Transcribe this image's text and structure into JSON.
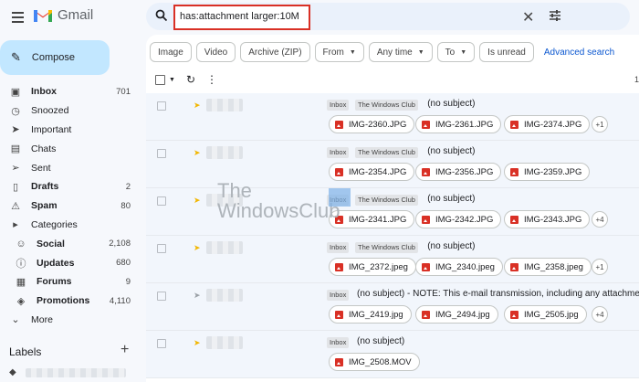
{
  "app": {
    "name": "Gmail"
  },
  "search": {
    "query": "has:attachment larger:10M"
  },
  "compose_label": "Compose",
  "nav": [
    {
      "icon": "inbox-icon",
      "glyph": "▣",
      "label": "Inbox",
      "count": "701",
      "bold": true,
      "sub": false
    },
    {
      "icon": "clock-icon",
      "glyph": "◷",
      "label": "Snoozed",
      "count": "",
      "bold": false,
      "sub": false
    },
    {
      "icon": "important-icon",
      "glyph": "➤",
      "label": "Important",
      "count": "",
      "bold": false,
      "sub": false
    },
    {
      "icon": "chat-icon",
      "glyph": "▤",
      "label": "Chats",
      "count": "",
      "bold": false,
      "sub": false
    },
    {
      "icon": "send-icon",
      "glyph": "➢",
      "label": "Sent",
      "count": "",
      "bold": false,
      "sub": false
    },
    {
      "icon": "draft-icon",
      "glyph": "▯",
      "label": "Drafts",
      "count": "2",
      "bold": true,
      "sub": false
    },
    {
      "icon": "spam-icon",
      "glyph": "⚠",
      "label": "Spam",
      "count": "80",
      "bold": true,
      "sub": false
    },
    {
      "icon": "label-icon",
      "glyph": "▸",
      "label": "Categories",
      "count": "",
      "bold": false,
      "sub": false
    },
    {
      "icon": "people-icon",
      "glyph": "☺",
      "label": "Social",
      "count": "2,108",
      "bold": true,
      "sub": true
    },
    {
      "icon": "info-icon",
      "glyph": "ⓘ",
      "label": "Updates",
      "count": "680",
      "bold": true,
      "sub": true
    },
    {
      "icon": "forum-icon",
      "glyph": "▦",
      "label": "Forums",
      "count": "9",
      "bold": true,
      "sub": true
    },
    {
      "icon": "tag-icon",
      "glyph": "◈",
      "label": "Promotions",
      "count": "4,110",
      "bold": true,
      "sub": true
    },
    {
      "icon": "chevron-down-icon",
      "glyph": "⌄",
      "label": "More",
      "count": "",
      "bold": false,
      "sub": false
    }
  ],
  "labels_header": "Labels",
  "filters": {
    "image": "Image",
    "video": "Video",
    "archive": "Archive (ZIP)",
    "from": "From",
    "any_time": "Any time",
    "to": "To",
    "is_unread": "Is unread",
    "advanced": "Advanced search"
  },
  "pager": "1",
  "rows": [
    {
      "tags": [
        "Inbox",
        "The Windows Club"
      ],
      "subject": "(no subject)",
      "important": true,
      "attachments": [
        "IMG-2360.JPG",
        "IMG-2361.JPG",
        "IMG-2374.JPG"
      ],
      "more": "+1"
    },
    {
      "tags": [
        "Inbox",
        "The Windows Club"
      ],
      "subject": "(no subject)",
      "important": true,
      "attachments": [
        "IMG-2354.JPG",
        "IMG-2356.JPG",
        "IMG-2359.JPG"
      ],
      "more": ""
    },
    {
      "tags": [
        "Inbox",
        "The Windows Club"
      ],
      "subject": "(no subject)",
      "important": true,
      "attachments": [
        "IMG-2341.JPG",
        "IMG-2342.JPG",
        "IMG-2343.JPG"
      ],
      "more": "+4"
    },
    {
      "tags": [
        "Inbox",
        "The Windows Club"
      ],
      "subject": "(no subject)",
      "important": true,
      "attachments": [
        "IMG_2372.jpeg",
        "IMG_2340.jpeg",
        "IMG_2358.jpeg"
      ],
      "more": "+1"
    },
    {
      "tags": [
        "Inbox"
      ],
      "subject": "(no subject) - NOTE: This e-mail transmission, including any attachments, is i",
      "important": false,
      "attachments": [
        "IMG_2419.jpg",
        "IMG_2494.jpg",
        "IMG_2505.jpg"
      ],
      "more": "+4"
    },
    {
      "tags": [
        "Inbox"
      ],
      "subject": "(no subject)",
      "important": true,
      "attachments": [
        "IMG_2508.MOV"
      ],
      "more": ""
    }
  ],
  "watermark": {
    "line1": "The",
    "line2": "WindowsClub"
  },
  "colors": {
    "accent": "#0b57d0",
    "highlight_border": "#d93025",
    "compose_bg": "#c2e7ff"
  }
}
